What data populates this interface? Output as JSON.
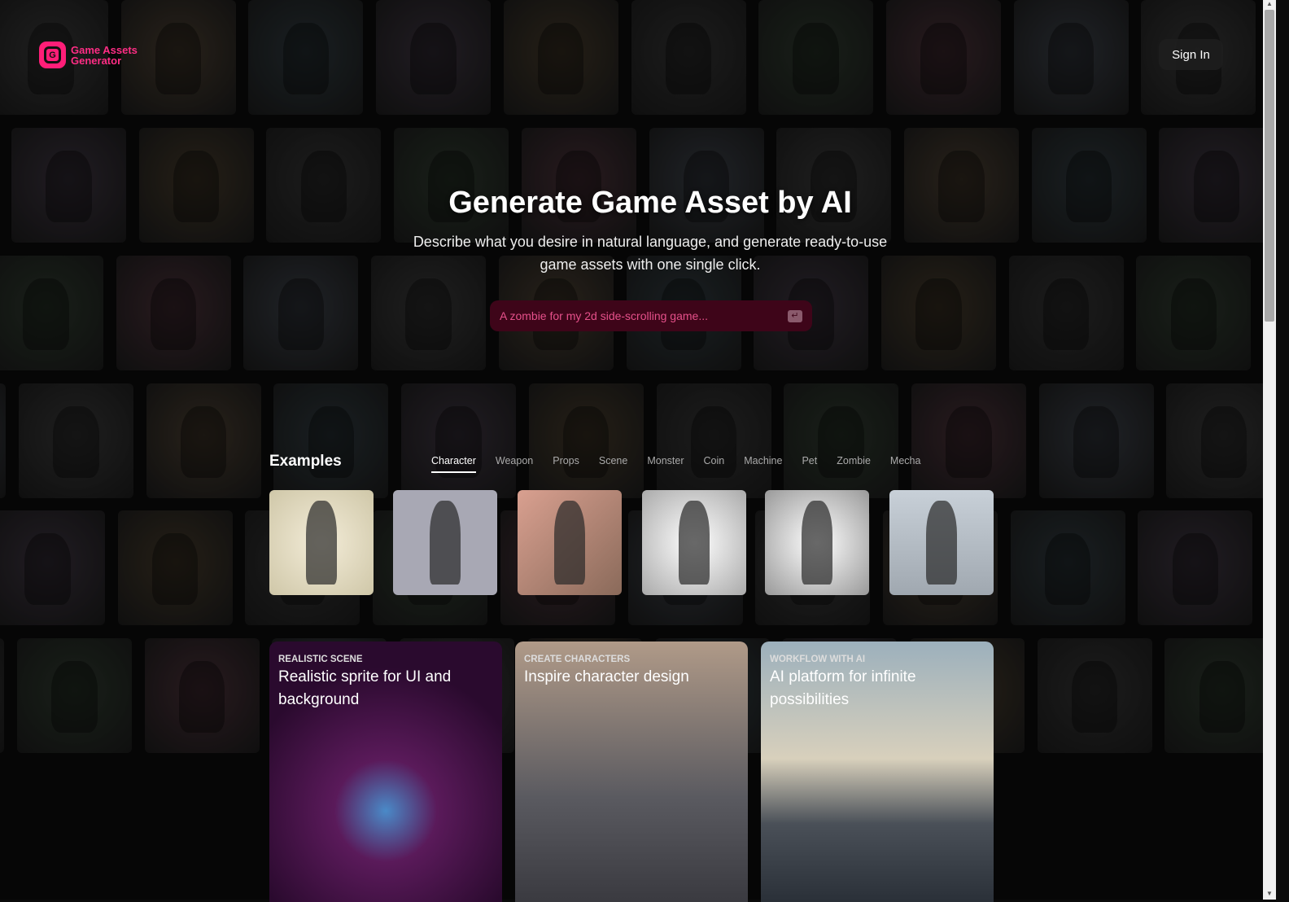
{
  "header": {
    "logo_icon": "G",
    "logo_line1": "Game Assets",
    "logo_line2": "Generator",
    "sign_in": "Sign In",
    "brand_color": "#ff1e78"
  },
  "hero": {
    "title": "Generate Game Asset by AI",
    "subtitle": "Describe what you desire in natural language, and generate ready-to-use game assets with one single click.",
    "search_placeholder": "A zombie for my 2d side-scrolling game...",
    "enter_icon": "enter-key-icon"
  },
  "examples": {
    "title": "Examples",
    "tabs": [
      {
        "label": "Character",
        "active": true
      },
      {
        "label": "Weapon"
      },
      {
        "label": "Props"
      },
      {
        "label": "Scene"
      },
      {
        "label": "Monster"
      },
      {
        "label": "Coin"
      },
      {
        "label": "Machine"
      },
      {
        "label": "Pet"
      },
      {
        "label": "Zombie"
      },
      {
        "label": "Mecha"
      }
    ]
  },
  "features": [
    {
      "kicker": "REALISTIC SCENE",
      "title": "Realistic sprite for UI and background"
    },
    {
      "kicker": "CREATE CHARACTERS",
      "title": "Inspire character design"
    },
    {
      "kicker": "WORKFLOW WITH AI",
      "title": "AI platform for infinite possibilities"
    }
  ]
}
